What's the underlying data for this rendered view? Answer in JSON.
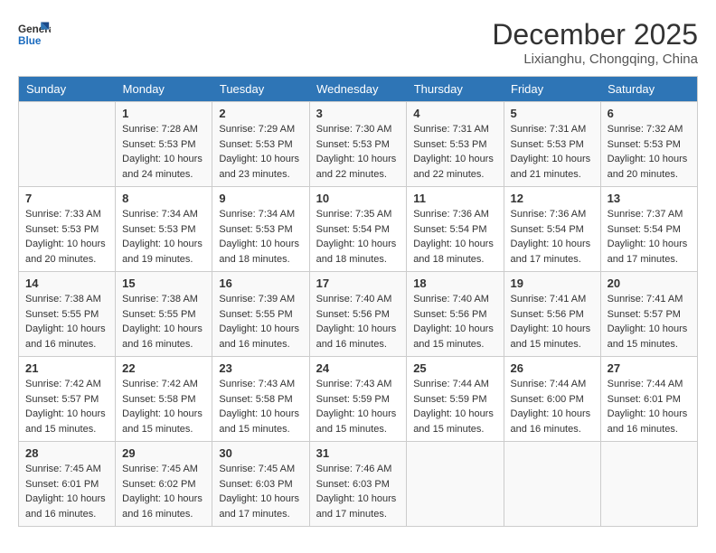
{
  "header": {
    "logo_line1": "General",
    "logo_line2": "Blue",
    "month": "December 2025",
    "location": "Lixianghu, Chongqing, China"
  },
  "weekdays": [
    "Sunday",
    "Monday",
    "Tuesday",
    "Wednesday",
    "Thursday",
    "Friday",
    "Saturday"
  ],
  "weeks": [
    [
      {
        "day": "",
        "info": ""
      },
      {
        "day": "1",
        "info": "Sunrise: 7:28 AM\nSunset: 5:53 PM\nDaylight: 10 hours\nand 24 minutes."
      },
      {
        "day": "2",
        "info": "Sunrise: 7:29 AM\nSunset: 5:53 PM\nDaylight: 10 hours\nand 23 minutes."
      },
      {
        "day": "3",
        "info": "Sunrise: 7:30 AM\nSunset: 5:53 PM\nDaylight: 10 hours\nand 22 minutes."
      },
      {
        "day": "4",
        "info": "Sunrise: 7:31 AM\nSunset: 5:53 PM\nDaylight: 10 hours\nand 22 minutes."
      },
      {
        "day": "5",
        "info": "Sunrise: 7:31 AM\nSunset: 5:53 PM\nDaylight: 10 hours\nand 21 minutes."
      },
      {
        "day": "6",
        "info": "Sunrise: 7:32 AM\nSunset: 5:53 PM\nDaylight: 10 hours\nand 20 minutes."
      }
    ],
    [
      {
        "day": "7",
        "info": "Sunrise: 7:33 AM\nSunset: 5:53 PM\nDaylight: 10 hours\nand 20 minutes."
      },
      {
        "day": "8",
        "info": "Sunrise: 7:34 AM\nSunset: 5:53 PM\nDaylight: 10 hours\nand 19 minutes."
      },
      {
        "day": "9",
        "info": "Sunrise: 7:34 AM\nSunset: 5:53 PM\nDaylight: 10 hours\nand 18 minutes."
      },
      {
        "day": "10",
        "info": "Sunrise: 7:35 AM\nSunset: 5:54 PM\nDaylight: 10 hours\nand 18 minutes."
      },
      {
        "day": "11",
        "info": "Sunrise: 7:36 AM\nSunset: 5:54 PM\nDaylight: 10 hours\nand 18 minutes."
      },
      {
        "day": "12",
        "info": "Sunrise: 7:36 AM\nSunset: 5:54 PM\nDaylight: 10 hours\nand 17 minutes."
      },
      {
        "day": "13",
        "info": "Sunrise: 7:37 AM\nSunset: 5:54 PM\nDaylight: 10 hours\nand 17 minutes."
      }
    ],
    [
      {
        "day": "14",
        "info": "Sunrise: 7:38 AM\nSunset: 5:55 PM\nDaylight: 10 hours\nand 16 minutes."
      },
      {
        "day": "15",
        "info": "Sunrise: 7:38 AM\nSunset: 5:55 PM\nDaylight: 10 hours\nand 16 minutes."
      },
      {
        "day": "16",
        "info": "Sunrise: 7:39 AM\nSunset: 5:55 PM\nDaylight: 10 hours\nand 16 minutes."
      },
      {
        "day": "17",
        "info": "Sunrise: 7:40 AM\nSunset: 5:56 PM\nDaylight: 10 hours\nand 16 minutes."
      },
      {
        "day": "18",
        "info": "Sunrise: 7:40 AM\nSunset: 5:56 PM\nDaylight: 10 hours\nand 15 minutes."
      },
      {
        "day": "19",
        "info": "Sunrise: 7:41 AM\nSunset: 5:56 PM\nDaylight: 10 hours\nand 15 minutes."
      },
      {
        "day": "20",
        "info": "Sunrise: 7:41 AM\nSunset: 5:57 PM\nDaylight: 10 hours\nand 15 minutes."
      }
    ],
    [
      {
        "day": "21",
        "info": "Sunrise: 7:42 AM\nSunset: 5:57 PM\nDaylight: 10 hours\nand 15 minutes."
      },
      {
        "day": "22",
        "info": "Sunrise: 7:42 AM\nSunset: 5:58 PM\nDaylight: 10 hours\nand 15 minutes."
      },
      {
        "day": "23",
        "info": "Sunrise: 7:43 AM\nSunset: 5:58 PM\nDaylight: 10 hours\nand 15 minutes."
      },
      {
        "day": "24",
        "info": "Sunrise: 7:43 AM\nSunset: 5:59 PM\nDaylight: 10 hours\nand 15 minutes."
      },
      {
        "day": "25",
        "info": "Sunrise: 7:44 AM\nSunset: 5:59 PM\nDaylight: 10 hours\nand 15 minutes."
      },
      {
        "day": "26",
        "info": "Sunrise: 7:44 AM\nSunset: 6:00 PM\nDaylight: 10 hours\nand 16 minutes."
      },
      {
        "day": "27",
        "info": "Sunrise: 7:44 AM\nSunset: 6:01 PM\nDaylight: 10 hours\nand 16 minutes."
      }
    ],
    [
      {
        "day": "28",
        "info": "Sunrise: 7:45 AM\nSunset: 6:01 PM\nDaylight: 10 hours\nand 16 minutes."
      },
      {
        "day": "29",
        "info": "Sunrise: 7:45 AM\nSunset: 6:02 PM\nDaylight: 10 hours\nand 16 minutes."
      },
      {
        "day": "30",
        "info": "Sunrise: 7:45 AM\nSunset: 6:03 PM\nDaylight: 10 hours\nand 17 minutes."
      },
      {
        "day": "31",
        "info": "Sunrise: 7:46 AM\nSunset: 6:03 PM\nDaylight: 10 hours\nand 17 minutes."
      },
      {
        "day": "",
        "info": ""
      },
      {
        "day": "",
        "info": ""
      },
      {
        "day": "",
        "info": ""
      }
    ]
  ]
}
